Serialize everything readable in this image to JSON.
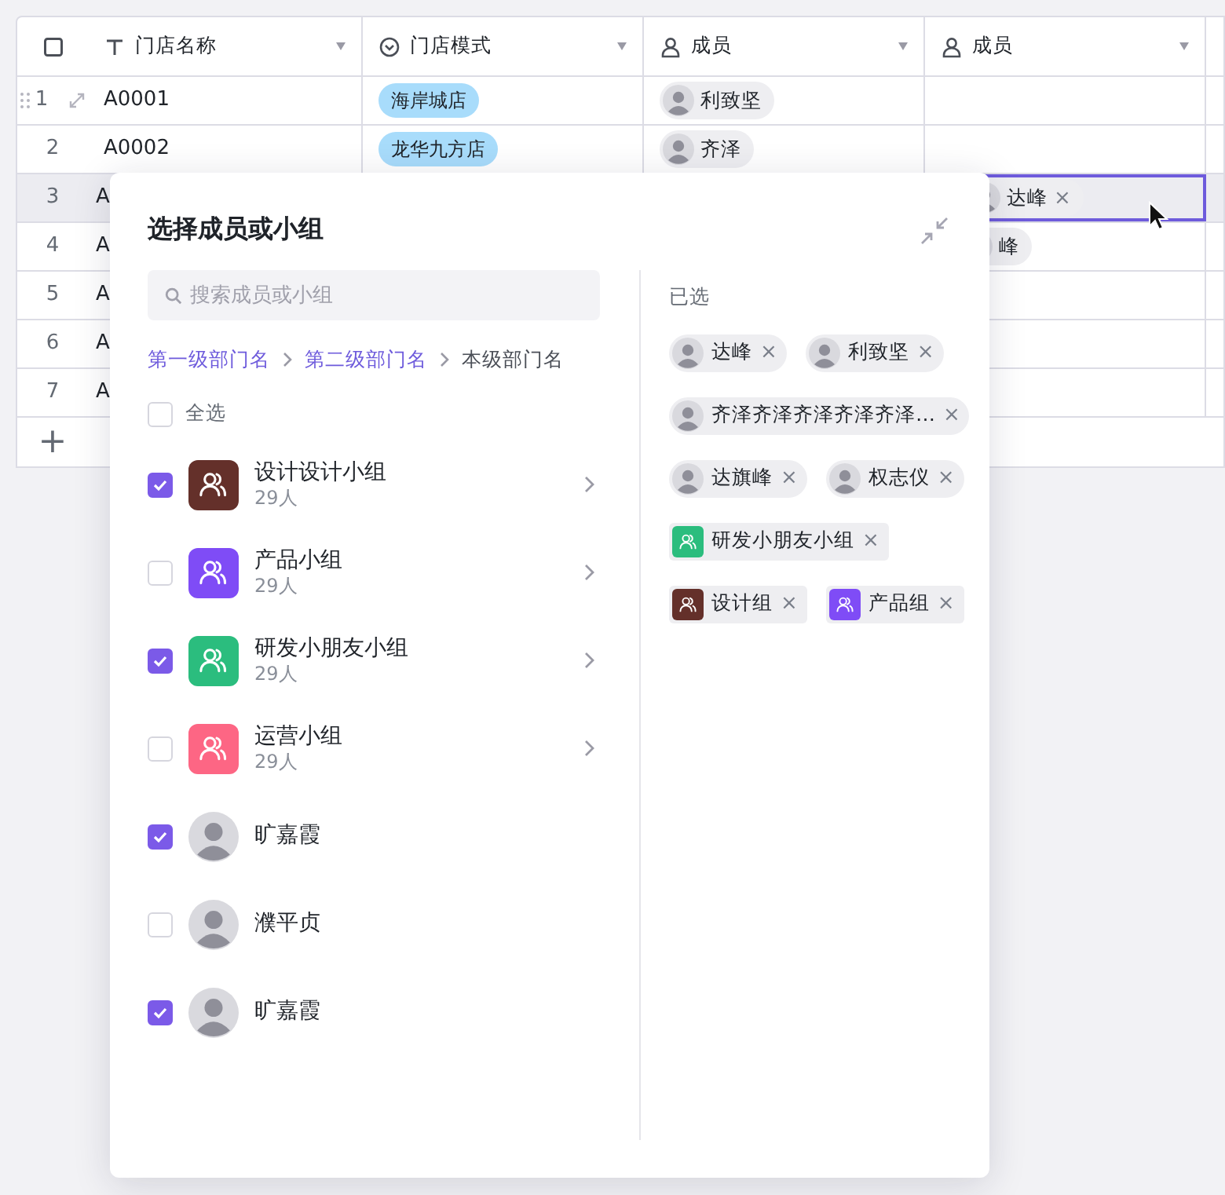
{
  "table": {
    "select_all": {
      "checked": false
    },
    "columns": [
      {
        "label": "门店名称",
        "kind": "text"
      },
      {
        "label": "门店模式",
        "kind": "select"
      },
      {
        "label": "成员",
        "kind": "person"
      },
      {
        "label": "成员",
        "kind": "person"
      }
    ],
    "rows": [
      {
        "number": "1",
        "name": "A0001",
        "mode": "海岸城店",
        "members": [
          "利致坚"
        ],
        "show_handles": true,
        "highlighted": false,
        "active_cell": false
      },
      {
        "number": "2",
        "name": "A0002",
        "mode": "龙华九方店",
        "members": [
          "齐泽"
        ],
        "show_handles": false,
        "highlighted": false,
        "active_cell": false
      },
      {
        "number": "3",
        "name": "A",
        "members2": [
          {
            "name": "达峰",
            "remove": "×"
          }
        ],
        "show_handles": false,
        "highlighted": true,
        "active_cell": true
      },
      {
        "number": "4",
        "name": "A",
        "members2": [
          {
            "name": "峰"
          }
        ],
        "show_handles": false,
        "highlighted": false,
        "active_cell": false
      },
      {
        "number": "5",
        "name": "A",
        "show_handles": false,
        "highlighted": false,
        "active_cell": false
      },
      {
        "number": "6",
        "name": "A",
        "show_handles": false,
        "highlighted": false,
        "active_cell": false
      },
      {
        "number": "7",
        "name": "A",
        "show_handles": false,
        "highlighted": false,
        "active_cell": false
      }
    ],
    "add_row": "+"
  },
  "picker": {
    "title": "选择成员或小组",
    "search": {
      "placeholder": "搜索成员或小组"
    },
    "breadcrumb": [
      {
        "label": "第一级部门名",
        "current": false
      },
      {
        "label": "第二级部门名",
        "current": false
      },
      {
        "label": "本级部门名",
        "current": true
      }
    ],
    "select_all": {
      "label": "全选",
      "checked": false
    },
    "items": [
      {
        "kind": "group",
        "name": "设计设计小组",
        "count": "29人",
        "checked": true,
        "color": "#64302a"
      },
      {
        "kind": "group",
        "name": "产品小组",
        "count": "29人",
        "checked": false,
        "color": "#7f4cf6"
      },
      {
        "kind": "group",
        "name": "研发小朋友小组",
        "count": "29人",
        "checked": true,
        "color": "#2bbd7e"
      },
      {
        "kind": "group",
        "name": "运营小组",
        "count": "29人",
        "checked": false,
        "color": "#fd6684"
      },
      {
        "kind": "person",
        "name": "旷嘉霞",
        "checked": true
      },
      {
        "kind": "person",
        "name": "濮平贞",
        "checked": false
      },
      {
        "kind": "person",
        "name": "旷嘉霞",
        "checked": true
      }
    ],
    "selected_title": "已选",
    "selected": [
      {
        "kind": "person",
        "name": "达峰",
        "remove": "×"
      },
      {
        "kind": "person",
        "name": "利致坚",
        "remove": "×"
      },
      {
        "kind": "person",
        "name": "齐泽齐泽齐泽齐泽齐泽…",
        "remove": "×"
      },
      {
        "kind": "person",
        "name": "达旗峰",
        "remove": "×"
      },
      {
        "kind": "person",
        "name": "权志仪",
        "remove": "×"
      },
      {
        "kind": "group",
        "name": "研发小朋友小组",
        "color": "#2bbd7e",
        "remove": "×"
      },
      {
        "kind": "group",
        "name": "设计组",
        "color": "#64302a",
        "remove": "×"
      },
      {
        "kind": "group",
        "name": "产品组",
        "color": "#7f4cf6",
        "remove": "×"
      }
    ]
  }
}
